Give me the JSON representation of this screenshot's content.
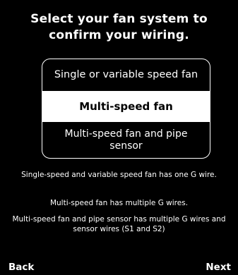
{
  "screen": {
    "title_line1": "Select your fan system to",
    "title_line2": "confirm your wiring."
  },
  "options": [
    {
      "label": "Single or variable speed fan",
      "selected": false
    },
    {
      "label": "Multi-speed fan",
      "selected": true
    },
    {
      "label": "Multi-speed fan and pipe sensor",
      "selected": false
    }
  ],
  "descriptions": {
    "single": "Single-speed and variable speed fan has one G wire.",
    "multi": "Multi-speed fan has multiple G wires.",
    "multi_sensor": "Multi-speed fan and pipe sensor has multiple G wires and sensor wires (S1 and S2)"
  },
  "nav": {
    "back_label": "Back",
    "next_label": "Next"
  },
  "colors": {
    "background": "#000000",
    "foreground": "#ffffff",
    "selected_background": "#ffffff",
    "selected_text": "#000000"
  }
}
